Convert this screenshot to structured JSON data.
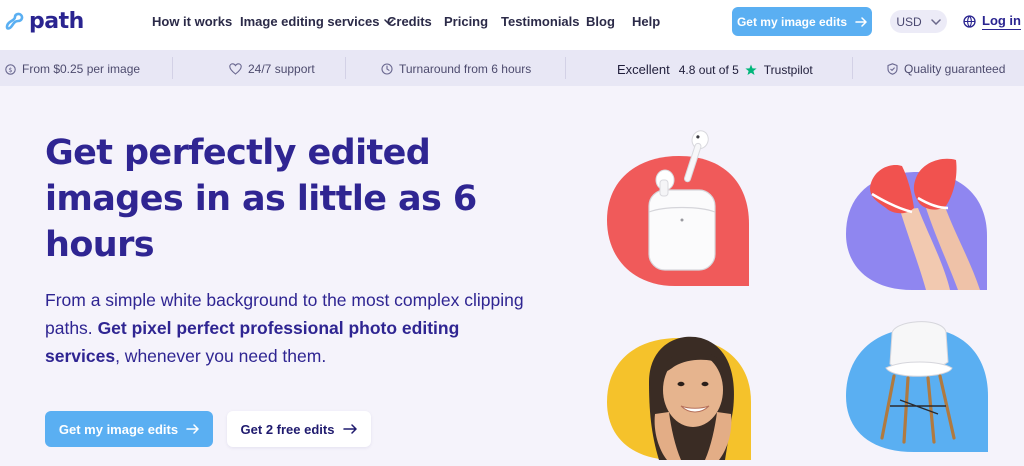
{
  "nav": {
    "logo_text": "path",
    "links": [
      {
        "label": "How it works"
      },
      {
        "label": "Image editing services"
      },
      {
        "label": "Credits"
      },
      {
        "label": "Pricing"
      },
      {
        "label": "Testimonials"
      },
      {
        "label": "Blog"
      },
      {
        "label": "Help"
      }
    ],
    "cta_label": "Get my image edits",
    "currency": "USD",
    "login_label": "Log in"
  },
  "trust": {
    "price": "From $0.25 per image",
    "support": "24/7 support",
    "turnaround": "Turnaround from 6 hours",
    "rating_word": "Excellent",
    "rating_score": "4.8 out of 5",
    "rating_brand": "Trustpilot",
    "quality": "Quality guaranteed"
  },
  "hero": {
    "headline": "Get perfectly edited images in as little as 6 hours",
    "sub_intro": "From a simple white background to the most complex clipping paths.",
    "sub_bold": "Get pixel perfect professional photo editing services",
    "sub_outro": ", whenever you need them.",
    "cta_primary": "Get my image edits",
    "cta_secondary": "Get 2 free edits"
  },
  "colors": {
    "brand": "#2f2592",
    "accent": "#5aaff2",
    "tile_coral": "#f05a5a",
    "tile_purple": "#8f86f0",
    "tile_yellow": "#f5c22b",
    "tile_blue": "#5aaff2",
    "trustpilot_green": "#00b67a"
  },
  "icons": [
    "path-logo-icon",
    "chevron-down-icon",
    "arrow-right-icon",
    "globe-icon",
    "coin-icon",
    "heart-icon",
    "clock-icon",
    "star-icon",
    "shield-icon"
  ]
}
